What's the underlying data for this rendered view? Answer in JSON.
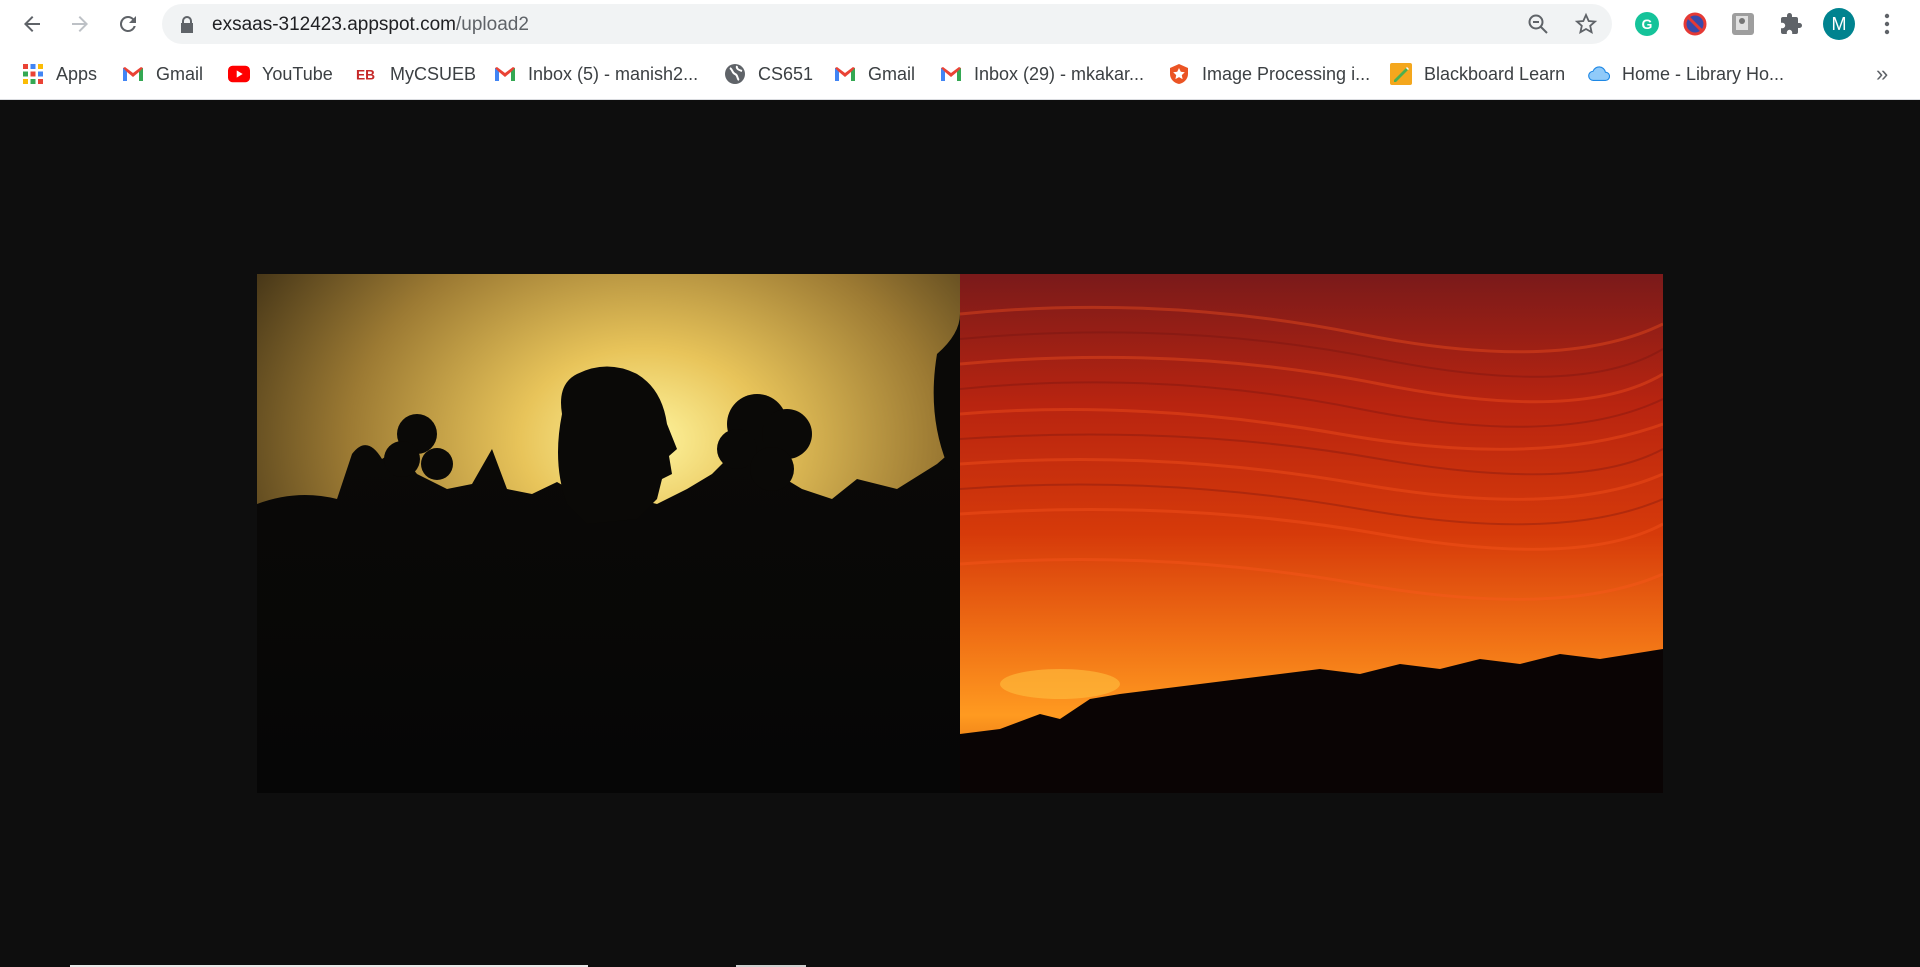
{
  "browser": {
    "url_host": "exsaas-312423.appspot.com",
    "url_path": "/upload2",
    "profile_initial": "M",
    "icons": {
      "back": "arrow-left-icon",
      "forward": "arrow-right-icon",
      "reload": "reload-icon",
      "lock": "lock-icon",
      "zoom": "zoom-out-icon",
      "star": "star-icon",
      "extensions": "puzzle-icon",
      "menu": "kebab-menu-icon"
    }
  },
  "bookmarks": [
    {
      "label": "Apps",
      "icon": "apps-grid-icon"
    },
    {
      "label": "Gmail",
      "icon": "gmail-icon"
    },
    {
      "label": "YouTube",
      "icon": "youtube-icon"
    },
    {
      "label": "MyCSUEB",
      "icon": "eb-icon"
    },
    {
      "label": "Inbox (5) - manish2...",
      "icon": "gmail-icon"
    },
    {
      "label": "CS651",
      "icon": "globe-icon"
    },
    {
      "label": "Gmail",
      "icon": "gmail-icon"
    },
    {
      "label": "Inbox (29) - mkakar...",
      "icon": "gmail-icon"
    },
    {
      "label": "Image Processing i...",
      "icon": "shield-icon"
    },
    {
      "label": "Blackboard Learn",
      "icon": "blackboard-icon"
    },
    {
      "label": "Home - Library Ho...",
      "icon": "cloud-icon"
    }
  ],
  "bookmarks_overflow": "»",
  "colors": {
    "page_background": "#0e0e0e",
    "profile_avatar": "#00838f",
    "gmail_red": "#ea4335",
    "youtube_red": "#ff0000"
  },
  "content": {
    "images": [
      {
        "name": "silhouette-sunset-photo"
      },
      {
        "name": "red-sky-sunset-photo"
      }
    ]
  }
}
